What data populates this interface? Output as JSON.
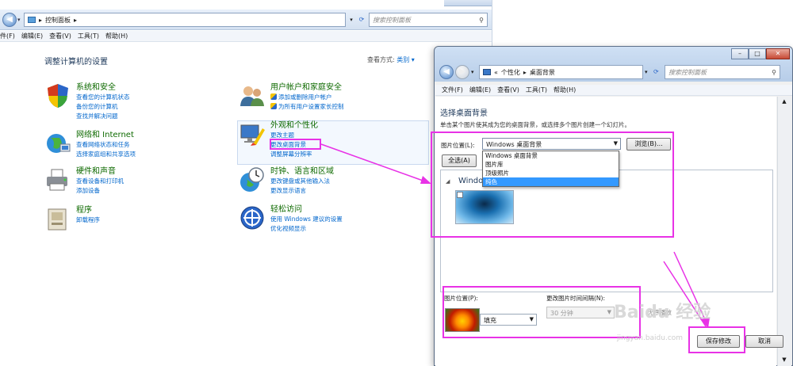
{
  "back_window": {
    "address_path": "控制面板",
    "search_placeholder": "搜索控制面板",
    "menu": [
      "件(F)",
      "编辑(E)",
      "查看(V)",
      "工具(T)",
      "帮助(H)"
    ],
    "heading": "调整计算机的设置",
    "view_by_label": "查看方式:",
    "view_by_value": "类别 ▾",
    "categories": [
      {
        "title": "系统和安全",
        "links": [
          "查看您的计算机状态",
          "备份您的计算机",
          "查找并解决问题"
        ]
      },
      {
        "title": "网络和 Internet",
        "links": [
          "查看网络状态和任务",
          "选择家庭组和共享选项"
        ]
      },
      {
        "title": "硬件和声音",
        "links": [
          "查看设备和打印机",
          "添加设备"
        ]
      },
      {
        "title": "程序",
        "links": [
          "卸载程序"
        ]
      },
      {
        "title": "用户帐户和家庭安全",
        "links": [
          "添加或删除用户帐户",
          "为所有用户设置家长控制"
        ]
      },
      {
        "title": "外观和个性化",
        "links": [
          "更改主题",
          "更改桌面背景",
          "调整屏幕分辨率"
        ]
      },
      {
        "title": "时钟、语言和区域",
        "links": [
          "更改键盘或其他输入法",
          "更改显示语言"
        ]
      },
      {
        "title": "轻松访问",
        "links": [
          "使用 Windows 建议的设置",
          "优化视频显示"
        ]
      }
    ]
  },
  "front_window": {
    "breadcrumb_prefix": "«",
    "breadcrumb": [
      "个性化",
      "桌面背景"
    ],
    "search_placeholder": "搜索控制面板",
    "menu": [
      "文件(F)",
      "编辑(E)",
      "查看(V)",
      "工具(T)",
      "帮助(H)"
    ],
    "title": "选择桌面背景",
    "description": "单击某个图片使其成为您的桌面背景，或选择多个图片创建一个幻灯片。",
    "location_label": "图片位置(L):",
    "location_value": "Windows 桌面背景",
    "browse_button": "浏览(B)...",
    "select_all_button": "全选(A)",
    "dropdown_options": [
      "Windows 桌面背景",
      "图片库",
      "顶级照片",
      "纯色"
    ],
    "dropdown_selected": "纯色",
    "gallery_group": "Windo",
    "position_label": "图片位置(P):",
    "position_value": "填充",
    "interval_label": "更改图片时间间隔(N):",
    "interval_value": "30 分钟",
    "shuffle_label": "无序播放",
    "save_button": "保存修改",
    "cancel_button": "取消"
  },
  "watermark": {
    "brand": "Baidu 经验",
    "url": "jingyan.baidu.com"
  },
  "colors": {
    "annotation": "#e832e6",
    "link": "#0066cc",
    "category_title": "#0e6a00",
    "selection": "#3399ff"
  }
}
